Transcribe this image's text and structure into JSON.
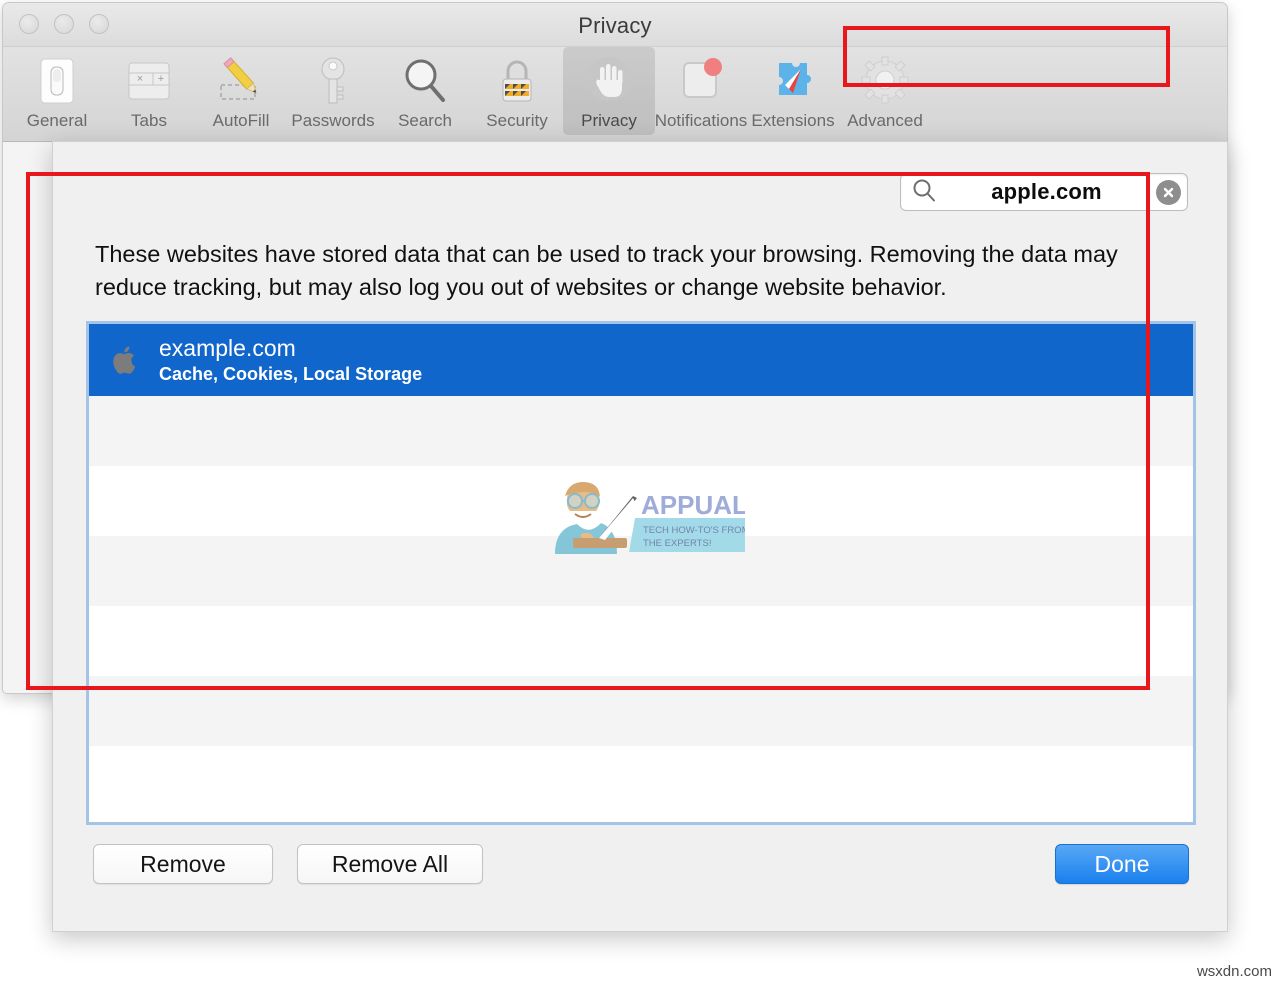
{
  "window": {
    "title": "Privacy",
    "traffic_lights": [
      "close-button",
      "minimize-button",
      "zoom-button"
    ]
  },
  "toolbar": {
    "items": [
      {
        "label": "General",
        "icon": "general-switch-icon",
        "selected": false
      },
      {
        "label": "Tabs",
        "icon": "tabs-icon",
        "selected": false
      },
      {
        "label": "AutoFill",
        "icon": "pencil-icon",
        "selected": false
      },
      {
        "label": "Passwords",
        "icon": "key-icon",
        "selected": false
      },
      {
        "label": "Search",
        "icon": "magnifier-icon",
        "selected": false
      },
      {
        "label": "Security",
        "icon": "padlock-icon",
        "selected": false
      },
      {
        "label": "Privacy",
        "icon": "hand-icon",
        "selected": true
      },
      {
        "label": "Notifications",
        "icon": "notification-dot-icon",
        "selected": false
      },
      {
        "label": "Extensions",
        "icon": "puzzle-compass-icon",
        "selected": false
      },
      {
        "label": "Advanced",
        "icon": "gear-icon",
        "selected": false
      }
    ]
  },
  "sheet": {
    "search": {
      "value": "apple.com",
      "placeholder": "Search",
      "search_icon": "magnifier-icon",
      "clear_icon": "clear-circle-x-icon"
    },
    "description": "These websites have stored data that can be used to track your browsing. Removing the data may reduce tracking, but may also log you out of websites or change website behavior.",
    "list": {
      "selected_index": 0,
      "rows": [
        {
          "site": "example.com",
          "details": "Cache, Cookies, Local Storage",
          "icon": "apple-logo-icon",
          "selected": true
        }
      ],
      "empty_row_count": 6
    },
    "buttons": {
      "remove": "Remove",
      "remove_all": "Remove All",
      "done": "Done"
    }
  },
  "watermarks": {
    "logo_text": "APPUALS",
    "logo_tagline_line1": "TECH HOW-TO'S FROM",
    "logo_tagline_line2": "THE EXPERTS!",
    "site": "wsxdn.com"
  },
  "colors": {
    "selection_blue": "#1166CC",
    "annotation_red": "#E8171C",
    "done_button_blue": "#1A80EE",
    "list_border_blue": "#A3C3E8"
  }
}
